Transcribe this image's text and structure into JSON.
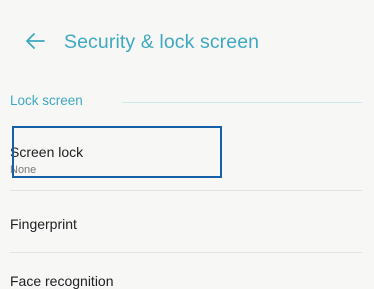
{
  "header": {
    "back_icon": "arrow-left-icon",
    "title": "Security & lock screen"
  },
  "section": {
    "label": "Lock screen"
  },
  "items": [
    {
      "title": "Screen lock",
      "subtitle": "None",
      "selected": true
    },
    {
      "title": "Fingerprint"
    },
    {
      "title": "Face recognition"
    }
  ],
  "colors": {
    "accent": "#3ea9c2",
    "highlight_border": "#1660a8",
    "background": "#f7f7f5"
  }
}
